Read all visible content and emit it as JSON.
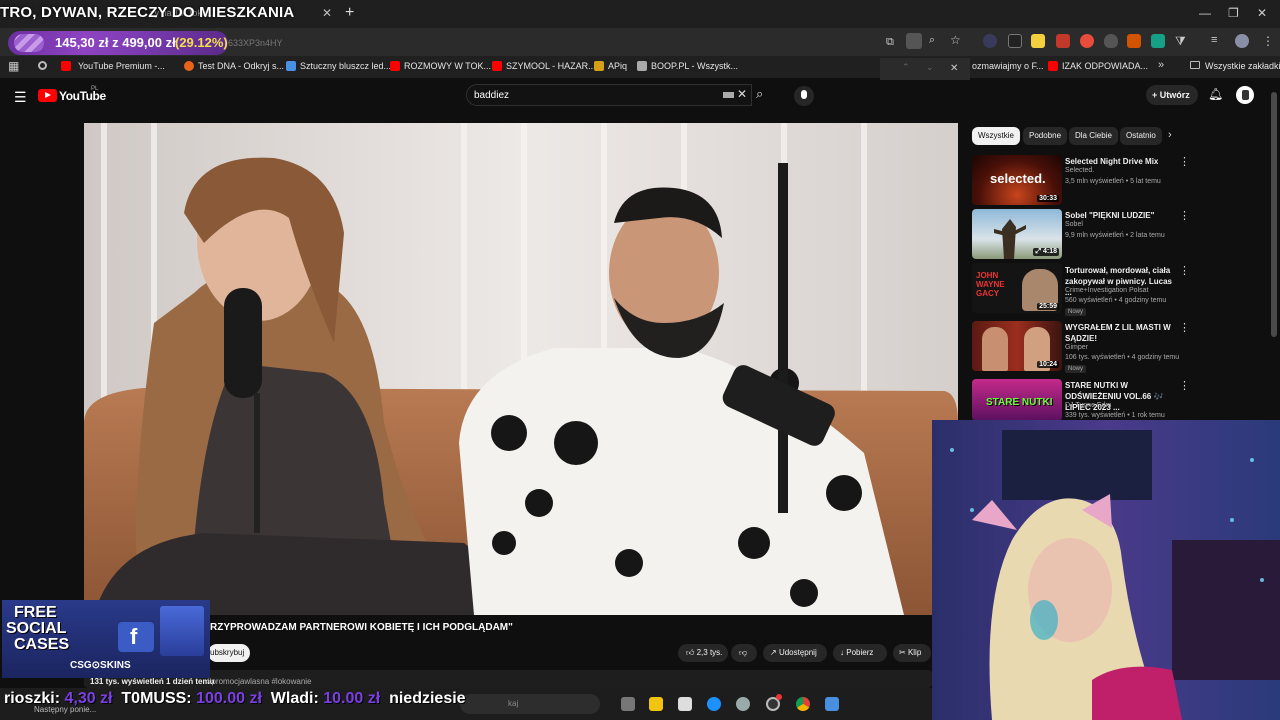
{
  "browser": {
    "stream_title": "TRO, DYWAN, RZECZY DO MIESZKANIA",
    "tab_ghost": "zy na Tik Toku...",
    "donation": {
      "amount": "145,30 zł z 499,00 zł",
      "percent": "(29.12%)",
      "progress": 0.2912
    },
    "url_ghost": "633XP3n4HY",
    "bookmarks": [
      {
        "label": "YouTube Premium -...",
        "color": "#ff0000"
      },
      {
        "label": "Test DNA - Odkryj s...",
        "color": "#e8641b"
      },
      {
        "label": "Sztuczny bluszcz led...",
        "color": "#4a90e2"
      },
      {
        "label": "ROZMOWY W TOK...",
        "color": "#ff0000"
      },
      {
        "label": "SZYMOOL - HAZAR...",
        "color": "#ff0000"
      },
      {
        "label": "APiq",
        "color": "#d4a017"
      },
      {
        "label": "BOOP.PL - Wszystk...",
        "color": "#aaaaaa"
      },
      {
        "label": "ozmawiajmy o F...",
        "color": "#ff0000"
      },
      {
        "label": "IZAK ODPOWIADA...",
        "color": "#ff0000"
      }
    ],
    "all_bookmarks": "Wszystkie zakładki"
  },
  "youtube": {
    "logo_text": "YouTube",
    "region": "PL",
    "search_value": "baddiez",
    "create_label": "Utwórz",
    "chips": [
      "Wszystkie",
      "Podobne",
      "Dla Ciebie",
      "Ostatnio"
    ],
    "related": [
      {
        "title": "Selected Night Drive Mix",
        "channel": "Selected.",
        "meta": "3,5 mln wyświetleń • 5 lat temu",
        "duration": "30:33",
        "thumb_text": "selected.",
        "new": ""
      },
      {
        "title": "Sobel \"PIĘKNI LUDZIE\"",
        "channel": "Sobel",
        "meta": "9,9 mln wyświetleń • 2 lata temu",
        "duration": "4:18",
        "thumb_text": "",
        "new": ""
      },
      {
        "title": "Torturował, mordował, ciała zakopywał w piwnicy. Lucas ...",
        "channel": "Crime+Investigation Polsat",
        "meta": "560 wyświetleń • 4 godziny temu",
        "duration": "25:59",
        "thumb_text": "JOHN WAYNE GACY",
        "new": "Nowy"
      },
      {
        "title": "WYGRAŁEM Z LIL MASTI W SĄDZIE!",
        "channel": "Gimper",
        "meta": "106 tys. wyświetleń • 4 godziny temu",
        "duration": "10:24",
        "thumb_text": "",
        "new": "Nowy"
      },
      {
        "title": "STARE NUTKI W ODŚWIEŻENIU VOL.66 🎶 LIPIEC 2023 ...",
        "channel": "DJ Tunne Edm",
        "meta": "339 tys. wyświetleń • 1 rok temu",
        "duration": "",
        "thumb_text": "STARE NUTKI",
        "new": ""
      }
    ],
    "video_title": "RZYPROWADZAM PARTNEROWI KOBIETĘ I ICH PODGLĄDAM\"",
    "subscribe_label": "ubskrybuj",
    "likes": "2,3 tys.",
    "share_label": "Udostępnij",
    "download_label": "Pobierz",
    "clip_label": "Klip",
    "views": "131 tys. wyświetleń  1 dzień temu",
    "tags": "#promocjawlasna #lokowanie"
  },
  "overlays": {
    "ad": {
      "line1": "FREE",
      "line2": "SOCIAL",
      "line3": "CASES",
      "brand": "CSG⊙SKINS"
    },
    "ticker": [
      {
        "name": "rioszki:",
        "amount": "4,30 zł"
      },
      {
        "name": "T0MUSS:",
        "amount": "100.00 zł"
      },
      {
        "name": "Wladi:",
        "amount": "10.00 zł"
      },
      {
        "name": "niedzie",
        "amount": ""
      }
    ],
    "ticker_tail": "sie",
    "next_ghost": "Następny ponie...",
    "taskbar_search": "kaj"
  },
  "colors": {
    "yt_red": "#ff0000",
    "donation_purple": "#8e44c2",
    "ticker_amount": "#7b3fe4",
    "percent_yellow": "#f4e04d"
  }
}
